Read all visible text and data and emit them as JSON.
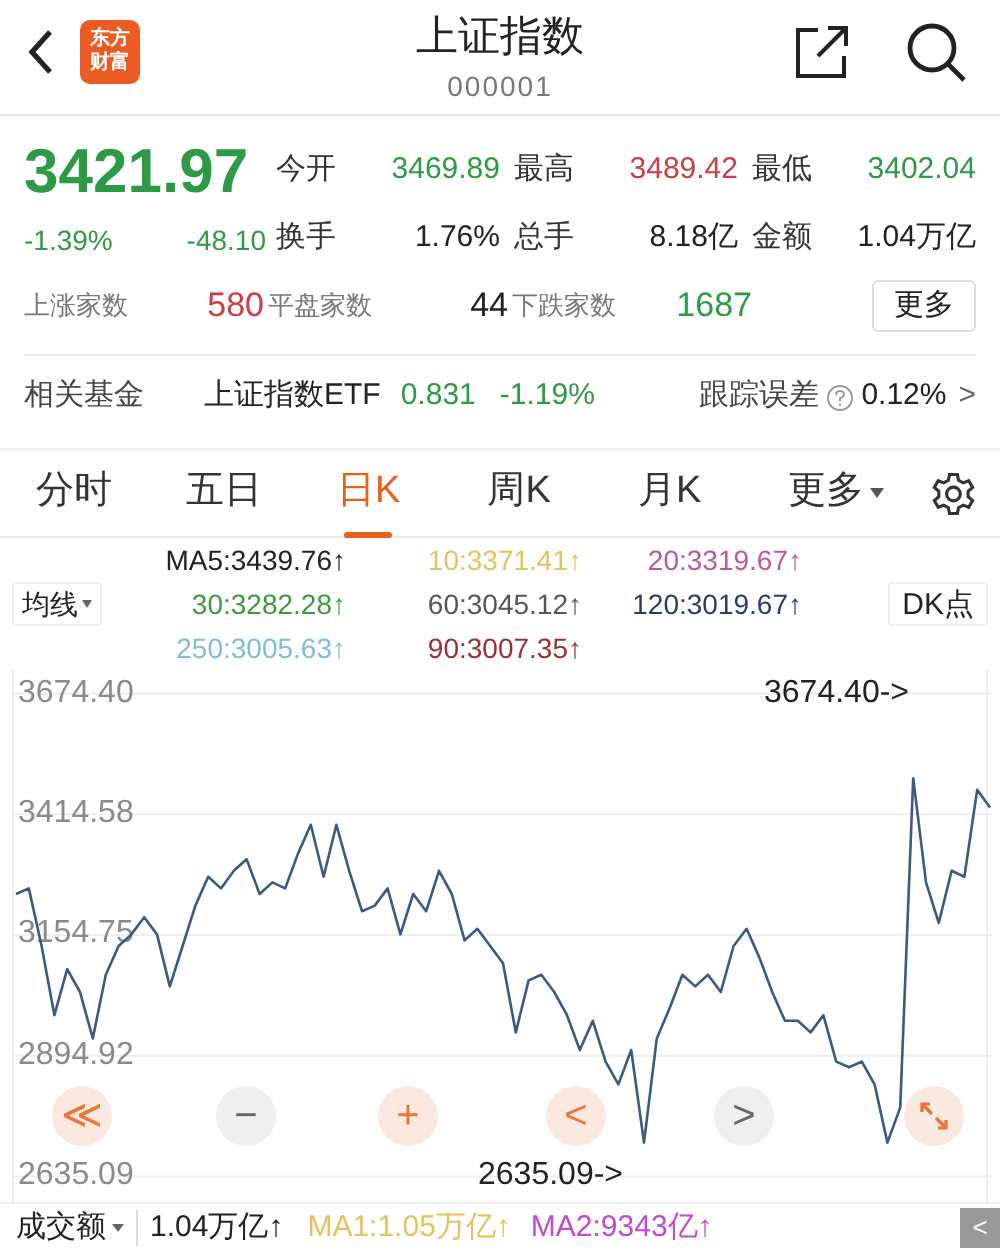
{
  "header": {
    "title": "上证指数",
    "code": "000001",
    "logo_text": [
      "东方",
      "财富"
    ]
  },
  "quote": {
    "price": "3421.97",
    "change_pct": "-1.39%",
    "change": "-48.10",
    "color": "#2e9a45",
    "stats": [
      {
        "label": "今开",
        "value": "3469.89",
        "color": "#2e9a45"
      },
      {
        "label": "最高",
        "value": "3489.42",
        "color": "#cc3d45"
      },
      {
        "label": "最低",
        "value": "3402.04",
        "color": "#2e9a45"
      },
      {
        "label": "换手",
        "value": "1.76%",
        "color": "#222222"
      },
      {
        "label": "总手",
        "value": "8.18亿",
        "color": "#222222"
      },
      {
        "label": "金额",
        "value": "1.04万亿",
        "color": "#222222"
      }
    ]
  },
  "breadth": [
    {
      "label": "上涨家数",
      "value": "580",
      "color": "#cc3d45"
    },
    {
      "label": "平盘家数",
      "value": "44",
      "color": "#222222"
    },
    {
      "label": "下跌家数",
      "value": "1687",
      "color": "#2e9a45"
    }
  ],
  "more_button": "更多",
  "fund": {
    "label": "相关基金",
    "name": "上证指数ETF",
    "price": "0.831",
    "change": "-1.19%",
    "color": "#2e9a45",
    "tracking_label": "跟踪误差",
    "tracking_value": "0.12%",
    "chevron": ">"
  },
  "tabs": [
    {
      "label": "分时",
      "selected": false,
      "kind": "tab"
    },
    {
      "label": "五日",
      "selected": false,
      "kind": "tab"
    },
    {
      "label": "日K",
      "selected": true,
      "kind": "tab"
    },
    {
      "label": "周K",
      "selected": false,
      "kind": "tab"
    },
    {
      "label": "月K",
      "selected": false,
      "kind": "tab"
    },
    {
      "label": "更多",
      "selected": false,
      "kind": "dropdown"
    }
  ],
  "ma": {
    "selector": "均线",
    "dk_button": "DK点",
    "items": [
      {
        "label": "MA5:3439.76↑",
        "color": "#222222"
      },
      {
        "label": "10:3371.41↑",
        "color": "#e6c15e"
      },
      {
        "label": "20:3319.67↑",
        "color": "#c1559c"
      },
      {
        "label": "30:3282.28↑",
        "color": "#3c9a3c"
      },
      {
        "label": "60:3045.12↑",
        "color": "#555555"
      },
      {
        "label": "120:3019.67↑",
        "color": "#2c3a68"
      },
      {
        "label": "250:3005.63↑",
        "color": "#7fbcd8"
      },
      {
        "label": "90:3007.35↑",
        "color": "#9c2d35"
      }
    ]
  },
  "chart": {
    "chart_data": {
      "type": "line",
      "grid": true,
      "ylim": [
        2580,
        3725
      ],
      "yticks": [
        {
          "value": 3674.4,
          "label": "3674.40"
        },
        {
          "value": 3414.58,
          "label": "3414.58"
        },
        {
          "value": 3154.75,
          "label": "3154.75"
        },
        {
          "value": 2894.92,
          "label": "2894.92"
        },
        {
          "value": 2635.09,
          "label": "2635.09"
        }
      ],
      "series": [
        {
          "color": "#3a5a80",
          "values": [
            3243,
            3255,
            3131,
            2982,
            3081,
            3032,
            2932,
            3069,
            3131,
            3156,
            3193,
            3156,
            3044,
            3131,
            3218,
            3280,
            3255,
            3293,
            3318,
            3243,
            3268,
            3255,
            3330,
            3392,
            3280,
            3392,
            3293,
            3206,
            3218,
            3255,
            3156,
            3243,
            3206,
            3293,
            3243,
            3143,
            3168,
            3131,
            3094,
            2945,
            3057,
            3069,
            3032,
            2982,
            2907,
            2970,
            2882,
            2833,
            2907,
            2708,
            2932,
            2997,
            3069,
            3044,
            3069,
            3032,
            3131,
            3168,
            3106,
            3032,
            2970,
            2970,
            2945,
            2982,
            2882,
            2870,
            2882,
            2833,
            2708,
            2783,
            3492,
            3268,
            3181,
            3293,
            3280,
            3467,
            3429
          ]
        }
      ],
      "annotations": [
        {
          "text": "3674.40->"
        },
        {
          "text": "2635.09->"
        }
      ]
    },
    "controls": [
      {
        "kind": "text",
        "label": "≪",
        "accent": true
      },
      {
        "kind": "text",
        "label": "−",
        "accent": false
      },
      {
        "kind": "text",
        "label": "+",
        "accent": true
      },
      {
        "kind": "text",
        "label": "<",
        "accent": true
      },
      {
        "kind": "text",
        "label": ">",
        "accent": false
      },
      {
        "kind": "expand",
        "accent": true
      }
    ]
  },
  "volume": {
    "selector": "成交额",
    "value": "1.04万亿↑",
    "ma1": "MA1:1.05万亿↑",
    "ma2": "MA2:9343亿↑",
    "side_tab": "<"
  }
}
